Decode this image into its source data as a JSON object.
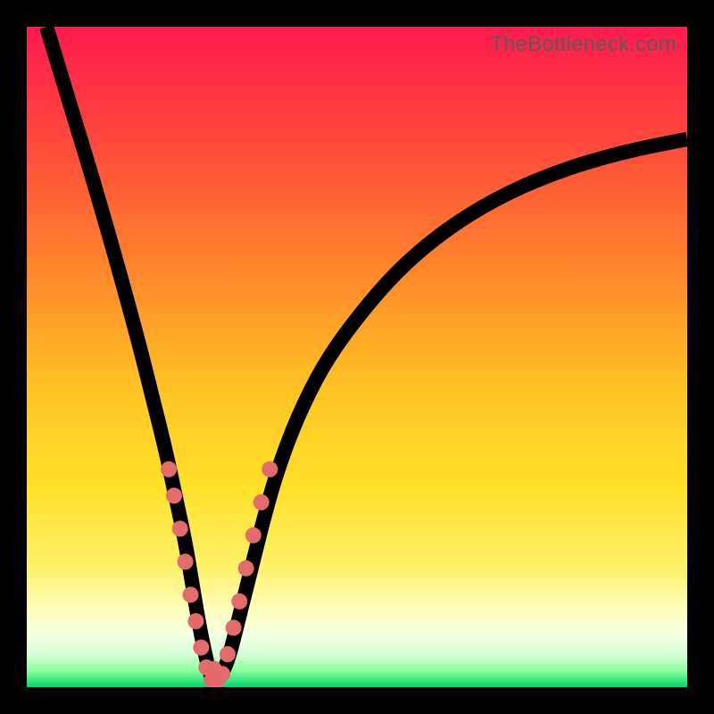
{
  "watermark": "TheBottleneck.com",
  "colors": {
    "frame": "#000000",
    "gradient_stops": [
      {
        "offset": 0.0,
        "color": "#ff1a4e"
      },
      {
        "offset": 0.18,
        "color": "#ff4b3b"
      },
      {
        "offset": 0.38,
        "color": "#ff8a2a"
      },
      {
        "offset": 0.55,
        "color": "#ffc423"
      },
      {
        "offset": 0.7,
        "color": "#ffe12a"
      },
      {
        "offset": 0.82,
        "color": "#fff26a"
      },
      {
        "offset": 0.88,
        "color": "#fffcb8"
      },
      {
        "offset": 0.92,
        "color": "#f6ffe2"
      },
      {
        "offset": 0.95,
        "color": "#d6ffd6"
      },
      {
        "offset": 0.975,
        "color": "#8bff9a"
      },
      {
        "offset": 1.0,
        "color": "#00d66a"
      }
    ],
    "dot_fill": "#e36b6b",
    "curve_stroke": "#000000"
  },
  "chart_data": {
    "type": "line",
    "title": "",
    "xlabel": "",
    "ylabel": "",
    "xlim": [
      0,
      100
    ],
    "ylim": [
      0,
      100
    ],
    "grid": false,
    "legend": false,
    "series": [
      {
        "name": "bottleneck-curve",
        "x": [
          3,
          6,
          10,
          14,
          17,
          19,
          21,
          22.5,
          24,
          25,
          26,
          27,
          28,
          29,
          30.5,
          32,
          34,
          36,
          38,
          41,
          45,
          50,
          56,
          63,
          71,
          80,
          90,
          100
        ],
        "y": [
          100,
          90,
          77,
          63,
          52,
          44,
          36,
          29,
          22,
          16,
          10,
          5,
          1,
          1,
          4,
          10,
          18,
          26,
          33,
          41,
          49,
          56,
          63,
          69,
          74,
          78,
          81,
          83
        ]
      }
    ],
    "markers": {
      "name": "highlight-dots",
      "points": [
        {
          "x": 21.5,
          "y": 33
        },
        {
          "x": 22.3,
          "y": 29
        },
        {
          "x": 23.2,
          "y": 24
        },
        {
          "x": 24.0,
          "y": 19
        },
        {
          "x": 24.8,
          "y": 14
        },
        {
          "x": 25.6,
          "y": 10
        },
        {
          "x": 26.4,
          "y": 6
        },
        {
          "x": 27.2,
          "y": 3
        },
        {
          "x": 28.0,
          "y": 1
        },
        {
          "x": 28.8,
          "y": 1
        },
        {
          "x": 29.6,
          "y": 2
        },
        {
          "x": 30.4,
          "y": 5
        },
        {
          "x": 31.3,
          "y": 9
        },
        {
          "x": 32.2,
          "y": 13
        },
        {
          "x": 33.2,
          "y": 18
        },
        {
          "x": 34.3,
          "y": 23
        },
        {
          "x": 35.5,
          "y": 28
        },
        {
          "x": 36.8,
          "y": 33
        }
      ],
      "radius": 9
    },
    "minimum_bar": {
      "x_start": 27.2,
      "x_end": 29.6,
      "y": 1,
      "height": 3
    }
  }
}
